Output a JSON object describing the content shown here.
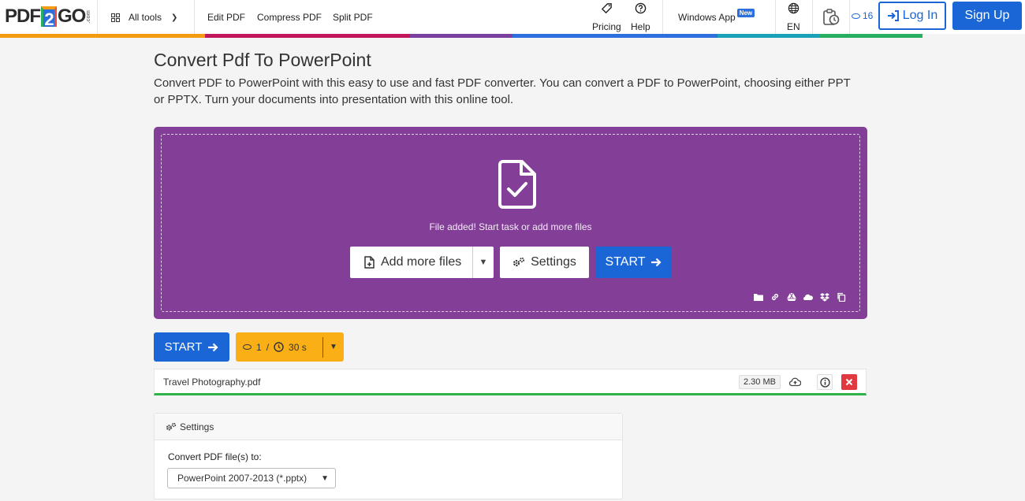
{
  "header": {
    "logo": {
      "pdf": "PDF",
      "two": "2",
      "go": "GO",
      "com": ".com"
    },
    "all_tools": "All tools",
    "nav_links": [
      "Edit PDF",
      "Compress PDF",
      "Split PDF"
    ],
    "pricing": "Pricing",
    "help": "Help",
    "windows_app": "Windows App",
    "new_badge": "New",
    "language": "EN",
    "credits": "16",
    "login": "Log In",
    "signup": "Sign Up",
    "stripe_colors": [
      "#f39c12",
      "#f39c12",
      "#c2185b",
      "#c2185b",
      "#7b3fa0",
      "#2d6fdc",
      "#2d6fdc",
      "#17a2b8",
      "#27ae60",
      "#f4f4f4"
    ]
  },
  "main": {
    "title": "Convert Pdf To PowerPoint",
    "description": "Convert PDF to PowerPoint with this easy to use and fast PDF converter. You can convert a PDF to PowerPoint, choosing either PPT or PPTX. Turn your documents into presentation with this online tool."
  },
  "dropzone": {
    "message": "File added! Start task or add more files",
    "add_more": "Add more files",
    "settings": "Settings",
    "start": "START",
    "color": "#833f97"
  },
  "actions": {
    "start": "START",
    "credits_used": "1",
    "time": "30 s"
  },
  "file": {
    "name": "Travel Photography.pdf",
    "size": "2.30 MB",
    "progress": 1.0
  },
  "settings": {
    "heading": "Settings",
    "convert_label": "Convert PDF file(s) to:",
    "selected_format": "PowerPoint 2007-2013 (*.pptx)"
  }
}
